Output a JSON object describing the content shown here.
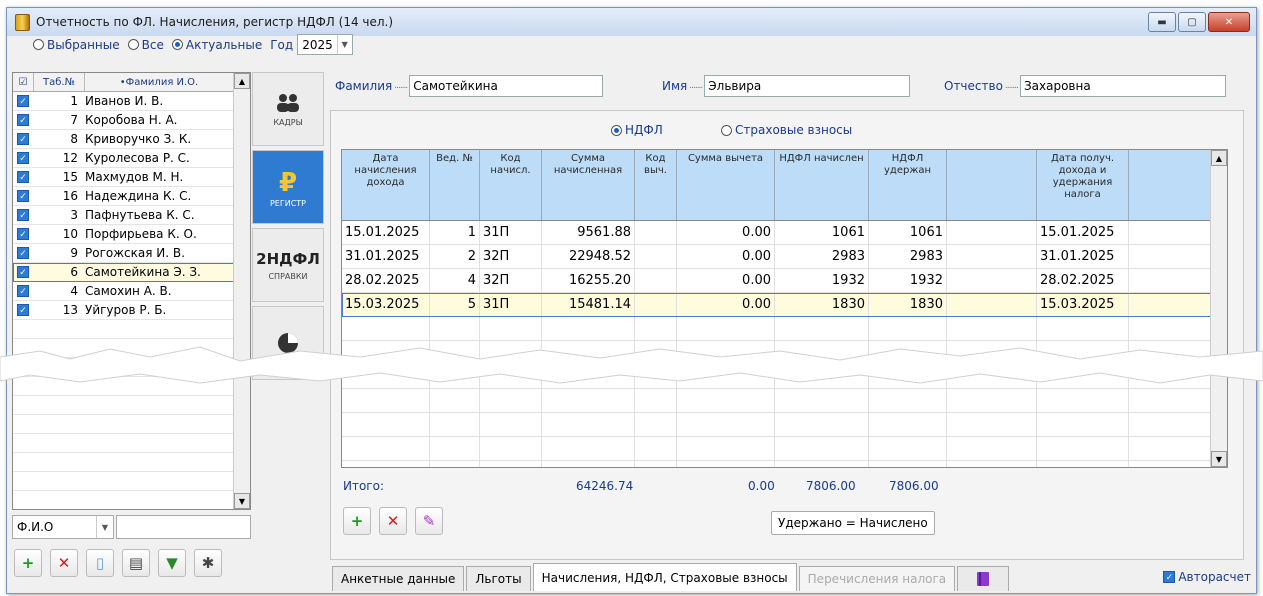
{
  "window": {
    "title": "Отчетность по ФЛ. Начисления, регистр НДФЛ (14 чел.)",
    "controls": [
      "minimize",
      "maximize",
      "close"
    ]
  },
  "filter_radios": {
    "options": [
      {
        "label": "Выбранные",
        "selected": false
      },
      {
        "label": "Все",
        "selected": false
      },
      {
        "label": "Актуальные",
        "selected": true
      }
    ],
    "year_label": "Год",
    "year_value": "2025"
  },
  "employees": {
    "headers": {
      "check": "☑",
      "tab_no": "Таб.№",
      "name": "•Фамилия И.О."
    },
    "rows": [
      {
        "tab": "1",
        "name": "Иванов И. В.",
        "checked": true
      },
      {
        "tab": "7",
        "name": "Коробова Н. А.",
        "checked": true
      },
      {
        "tab": "8",
        "name": "Криворучко З. К.",
        "checked": true
      },
      {
        "tab": "12",
        "name": "Куролесова Р. С.",
        "checked": true
      },
      {
        "tab": "15",
        "name": "Махмудов М. Н.",
        "checked": true
      },
      {
        "tab": "16",
        "name": "Надеждина К. С.",
        "checked": true
      },
      {
        "tab": "3",
        "name": "Пафнутьева К. С.",
        "checked": true
      },
      {
        "tab": "10",
        "name": "Порфирьева К. О.",
        "checked": true
      },
      {
        "tab": "9",
        "name": "Рогожская И. В.",
        "checked": true
      },
      {
        "tab": "6",
        "name": "Самотейкина Э. З.",
        "checked": true,
        "selected": true
      },
      {
        "tab": "4",
        "name": "Самохин А. В.",
        "checked": true
      },
      {
        "tab": "13",
        "name": "Уйгуров Р. Б.",
        "checked": true
      }
    ],
    "filter_field": "Ф.И.О"
  },
  "side_nav": [
    {
      "label": "КАДРЫ",
      "icon": "people-icon",
      "active": false
    },
    {
      "label": "РЕГИСТР",
      "icon": "ruble-icon",
      "active": true
    },
    {
      "title": "2НДФЛ",
      "label": "СПРАВКИ",
      "icon": "",
      "active": false
    },
    {
      "label": "",
      "icon": "pie-chart-icon",
      "active": false
    }
  ],
  "person": {
    "surname_label": "Фамилия",
    "surname": "Самотейкина",
    "name_label": "Имя",
    "name": "Эльвира",
    "patronymic_label": "Отчество",
    "patronymic": "Захаровна"
  },
  "mode_radios": [
    {
      "label": "НДФЛ",
      "selected": true
    },
    {
      "label": "Страховые взносы",
      "selected": false
    }
  ],
  "accruals": {
    "columns": [
      "Дата начисления дохода",
      "Вед. №",
      "Код начисл.",
      "Сумма начисленная",
      "Код выч.",
      "Сумма вычета",
      "НДФЛ начислен",
      "НДФЛ удержан",
      "",
      "Дата получ. дохода и удержания налога",
      ""
    ],
    "rows": [
      {
        "date": "15.01.2025",
        "ved": "1",
        "code": "31П",
        "sum": "9561.88",
        "dcode": "",
        "deduction": "0.00",
        "ndfl_acc": "1061",
        "ndfl_held": "1061",
        "date2": "15.01.2025"
      },
      {
        "date": "31.01.2025",
        "ved": "2",
        "code": "32П",
        "sum": "22948.52",
        "dcode": "",
        "deduction": "0.00",
        "ndfl_acc": "2983",
        "ndfl_held": "2983",
        "date2": "31.01.2025"
      },
      {
        "date": "28.02.2025",
        "ved": "4",
        "code": "32П",
        "sum": "16255.20",
        "dcode": "",
        "deduction": "0.00",
        "ndfl_acc": "1932",
        "ndfl_held": "1932",
        "date2": "28.02.2025"
      },
      {
        "date": "15.03.2025",
        "ved": "5",
        "code": "31П",
        "sum": "15481.14",
        "dcode": "",
        "deduction": "0.00",
        "ndfl_acc": "1830",
        "ndfl_held": "1830",
        "date2": "15.03.2025",
        "selected": true
      }
    ],
    "totals": {
      "label": "Итого:",
      "sum": "64246.74",
      "deduction": "0.00",
      "ndfl_acc": "7806.00",
      "ndfl_held": "7806.00"
    },
    "held_equals_button": "Удержано = Начислено"
  },
  "bottom_tabs": [
    {
      "label": "Анкетные данные",
      "active": false,
      "disabled": false
    },
    {
      "label": "Льготы",
      "active": false,
      "disabled": false
    },
    {
      "label": "Начисления, НДФЛ, Страховые взносы",
      "active": true,
      "disabled": false
    },
    {
      "label": "Перечисления налога",
      "active": false,
      "disabled": true
    }
  ],
  "autocalc": {
    "label": "Авторасчет",
    "checked": true
  },
  "colors": {
    "accent": "#2f7bd1",
    "grid_header": "#bcdcf7",
    "selected_row": "#fffbdd",
    "label_blue": "#1a3a8a"
  }
}
